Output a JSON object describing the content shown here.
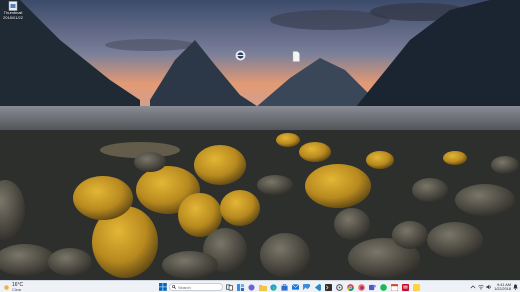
{
  "desktop": {
    "icons": [
      {
        "label": "Thumbnail",
        "sub": "2018/01/22",
        "icon": "file-icon"
      },
      {
        "label": "",
        "icon": "app-icon"
      },
      {
        "label": "",
        "icon": "document-icon"
      }
    ]
  },
  "taskbar": {
    "weather": {
      "temp": "16°C",
      "condition": "Clear",
      "icon": "weather-icon"
    },
    "start_icon": "windows-start-icon",
    "search_placeholder": "Search",
    "apps": [
      "task-view-icon",
      "widgets-icon",
      "chat-icon",
      "file-explorer-icon",
      "edge-icon",
      "store-icon",
      "mail-icon",
      "photos-icon",
      "vscode-icon",
      "terminal-icon",
      "settings-icon",
      "chrome-icon",
      "firefox-icon",
      "teams-icon",
      "spotify-icon",
      "calendar-icon",
      "news-icon",
      "notes-icon"
    ],
    "tray": {
      "time": "9:41 AM",
      "date": "1/22/2018"
    }
  },
  "colors": {
    "sky_top": "#3a4a6a",
    "sunset": "#e8906a",
    "taskbar": "#eef1f6",
    "accent": "#0067c0"
  }
}
